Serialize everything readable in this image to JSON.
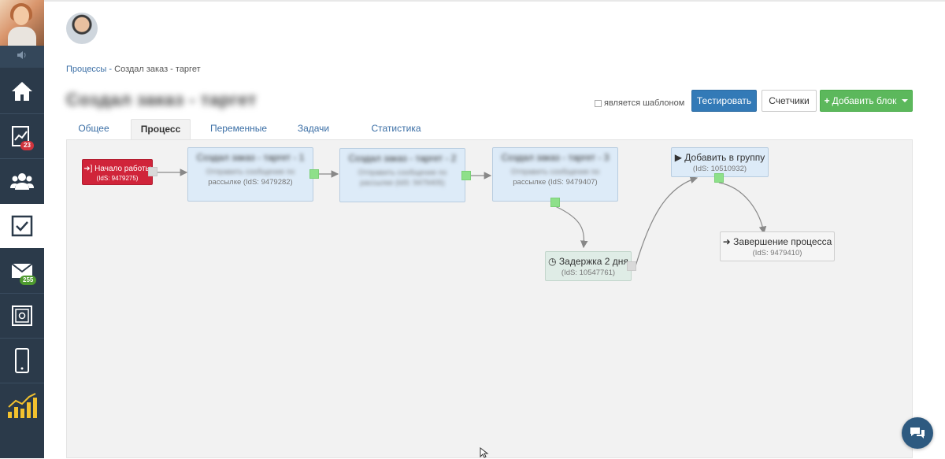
{
  "sidebar": {
    "badges": {
      "stats": "23",
      "mail": "255"
    },
    "items": [
      {
        "icon": "home-icon"
      },
      {
        "icon": "chart-icon"
      },
      {
        "icon": "users-icon"
      },
      {
        "icon": "checkbox-icon"
      },
      {
        "icon": "mail-icon"
      },
      {
        "icon": "safe-icon"
      },
      {
        "icon": "mobile-icon"
      },
      {
        "icon": "analytics-icon"
      }
    ]
  },
  "breadcrumb": {
    "parent": "Процессы -",
    "current": "Создал заказ - таргет"
  },
  "page": {
    "title": "Создал заказ - таргет"
  },
  "toolbar": {
    "template_label": "является шаблоном",
    "test_label": "Тестировать",
    "counters_label": "Счетчики",
    "add_block_label": "Добавить блок",
    "add_block_prefix": "+"
  },
  "tabs": [
    {
      "label": "Общее"
    },
    {
      "label": "Процесс"
    },
    {
      "label": "Переменные"
    },
    {
      "label": "Задачи"
    },
    {
      "label": "Статистика"
    }
  ],
  "nodes": {
    "start": {
      "title": "Начало работы",
      "id": "(IdS: 9479275)"
    },
    "block1": {
      "title": "Создал заказ - таргет - 1",
      "line2": "Отправить сообщение по",
      "line3": "рассылке (IdS: 9479282)"
    },
    "block2": {
      "title": "Создал заказ - таргет - 2",
      "line2": "Отправить сообщение по",
      "line3": "рассылке (IdS: 9479405)"
    },
    "block3": {
      "title": "Создал заказ - таргет - 3",
      "line2": "Отправить сообщение по",
      "line3": "рассылке (IdS: 9479407)"
    },
    "delay": {
      "title": "Задержка 2 дня",
      "id": "(IdS: 10547761)"
    },
    "group": {
      "title": "Добавить в группу",
      "id": "(IdS: 10510932)"
    },
    "end": {
      "title": "Завершение процесса",
      "id": "(IdS: 9479410)"
    }
  },
  "colors": {
    "sidebar": "#2b3a4a",
    "primary": "#337ab7",
    "success": "#5cb85c",
    "start": "#d0243a",
    "node": "#ddebf8"
  }
}
